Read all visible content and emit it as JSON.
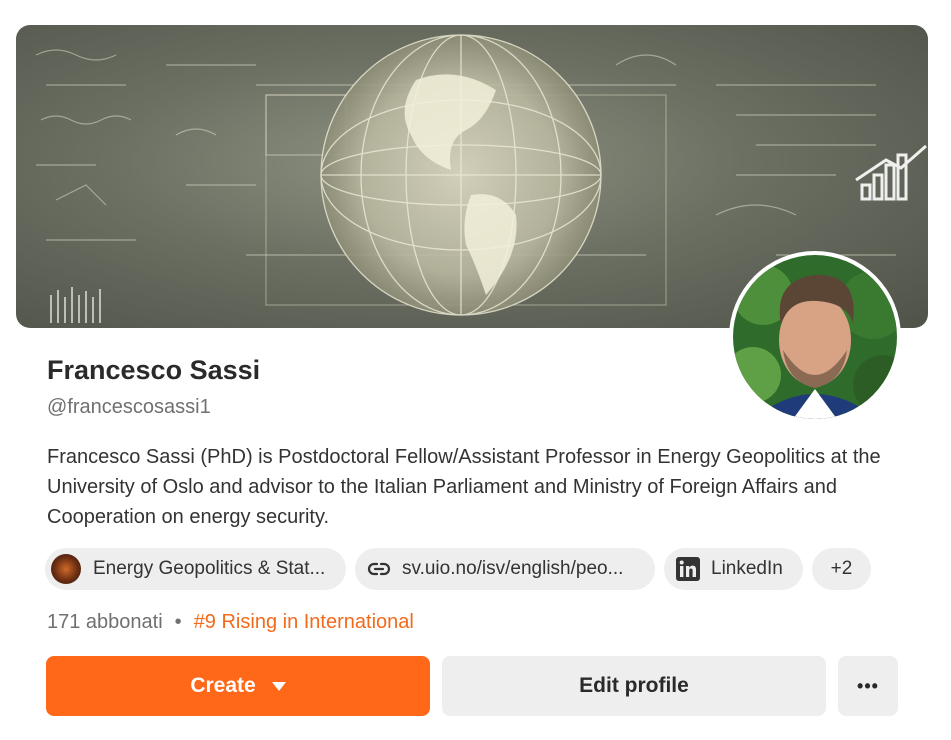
{
  "profile": {
    "name": "Francesco Sassi",
    "handle": "@francescosassi1",
    "bio": "Francesco Sassi (PhD) is Postdoctoral Fellow/Assistant Professor in Energy Geopolitics at the University of Oslo and advisor to the Italian Parliament and Ministry of Foreign Affairs and Cooperation on energy security."
  },
  "links": {
    "publication_label": "Energy Geopolitics & Stat...",
    "website_label": "sv.uio.no/isv/english/peo...",
    "linkedin_label": "LinkedIn",
    "more_label": "+2"
  },
  "stats": {
    "subscribers": "171 abbonati",
    "separator": "•",
    "rising": "#9 Rising in International"
  },
  "actions": {
    "create_label": "Create",
    "edit_label": "Edit profile",
    "more_label": "•••"
  },
  "colors": {
    "accent": "#ff6719",
    "rising_text": "#f26a1b",
    "chip_bg": "#eeeeee"
  },
  "icons": {
    "banner": "chalkboard-globe-image",
    "link": "link-icon",
    "linkedin": "linkedin-icon",
    "caret": "caret-down-icon",
    "more": "more-horizontal-icon"
  }
}
